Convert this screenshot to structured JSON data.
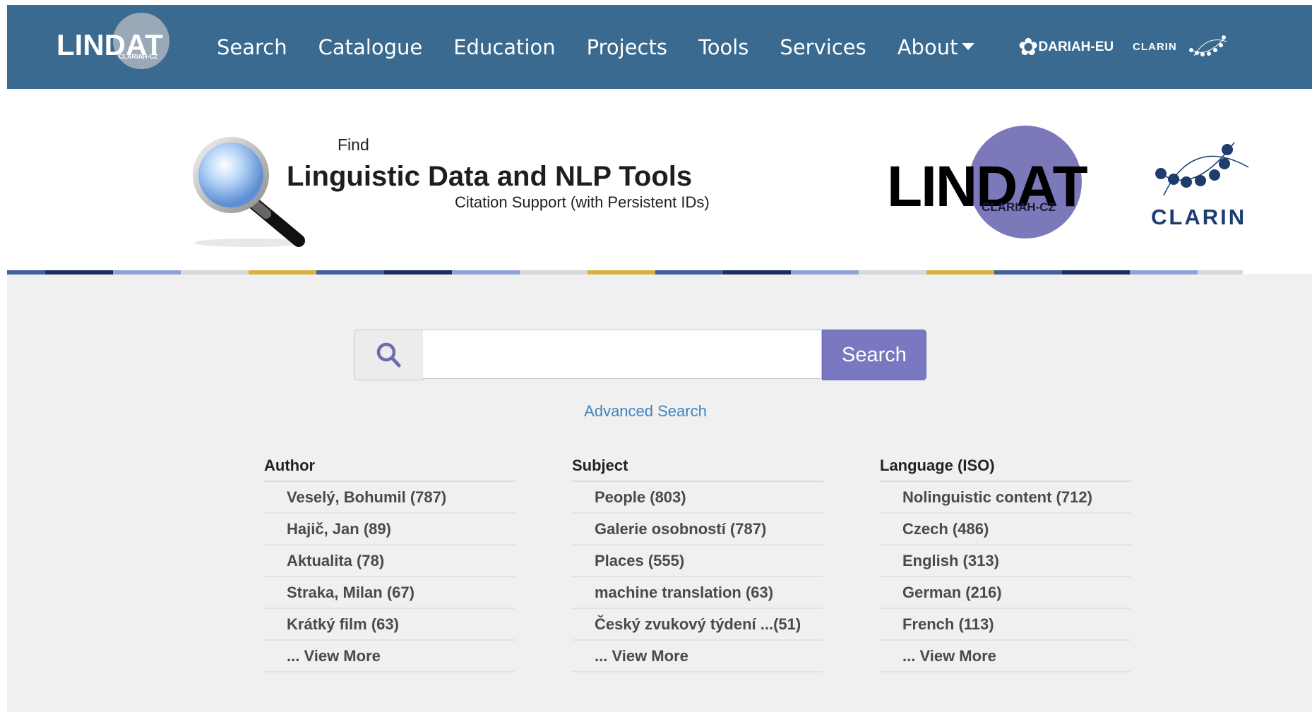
{
  "navbar": {
    "logo_text": "LINDAT",
    "logo_sub": "CLARIAH-CZ",
    "items": [
      "Search",
      "Catalogue",
      "Education",
      "Projects",
      "Tools",
      "Services",
      "About"
    ],
    "partners": {
      "dariah": "DARIAH-EU",
      "clarin": "CLARIN"
    }
  },
  "banner": {
    "find": "Find",
    "title": "Linguistic Data and NLP Tools",
    "subtitle": "Citation Support (with Persistent IDs)",
    "logo_text": "LINDAT",
    "logo_sub": "CLARIAH-CZ",
    "clarin": "CLARIN"
  },
  "search": {
    "placeholder": "",
    "value": "",
    "button": "Search",
    "advanced": "Advanced Search"
  },
  "facets": [
    {
      "heading": "Author",
      "items": [
        "Veselý, Bohumil (787)",
        "Hajič, Jan (89)",
        "Aktualita (78)",
        "Straka, Milan (67)",
        "Krátký film (63)",
        "... View More"
      ]
    },
    {
      "heading": "Subject",
      "items": [
        "People (803)",
        "Galerie osobností (787)",
        "Places (555)",
        "machine translation (63)",
        "Český zvukový týdení ...(51)",
        "... View More"
      ]
    },
    {
      "heading": "Language (ISO)",
      "items": [
        "Nolinguistic content (712)",
        "Czech (486)",
        "English (313)",
        "German (216)",
        "French (113)",
        "... View More"
      ]
    }
  ],
  "colors": {
    "navbar": "#3a6a8f",
    "accent": "#7a78c0",
    "link": "#3c85c2"
  }
}
